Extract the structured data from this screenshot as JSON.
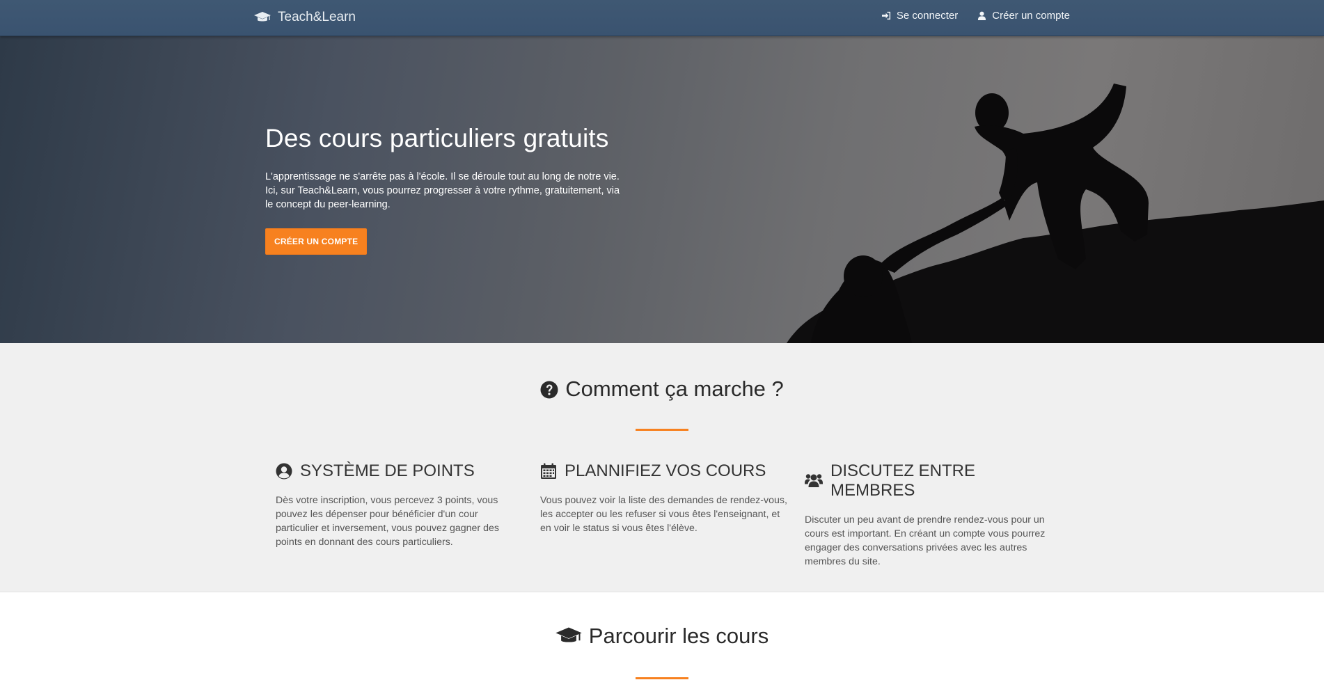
{
  "navbar": {
    "brand": "Teach&Learn",
    "brand_icon": "graduation-cap-icon",
    "links": [
      {
        "label": "Se connecter",
        "icon": "sign-in-icon"
      },
      {
        "label": "Créer un compte",
        "icon": "user-icon"
      }
    ]
  },
  "hero": {
    "title": "Des cours particuliers gratuits",
    "text": "L'apprentissage ne s'arrête pas à l'école. Il se déroule tout au long de notre vie. Ici, sur Teach&Learn, vous pourrez progresser à votre rythme, gratuitement, via le concept du peer-learning.",
    "cta": "CRÉER UN COMPTE"
  },
  "how": {
    "title": "Comment ça marche ?",
    "icon": "question-circle-icon",
    "features": [
      {
        "icon": "user-circle-icon",
        "title": "SYSTÈME DE POINTS",
        "text": "Dès votre inscription, vous percevez 3 points, vous pouvez les dépenser pour bénéficier d'un cour particulier et inversement, vous pouvez gagner des points en donnant des cours particuliers."
      },
      {
        "icon": "calendar-icon",
        "title": "PLANNIFIEZ VOS COURS",
        "text": "Vous pouvez voir la liste des demandes de rendez-vous, les accepter ou les refuser si vous êtes l'enseignant, et en voir le status si vous êtes l'élève."
      },
      {
        "icon": "users-icon",
        "title": "DISCUTEZ ENTRE MEMBRES",
        "text": "Discuter un peu avant de prendre rendez-vous pour un cours est important. En créant un compte vous pourrez engager des conversations privées avec les autres membres du site."
      }
    ]
  },
  "courses": {
    "title": "Parcourir les cours",
    "icon": "graduation-cap-icon"
  },
  "colors": {
    "navbar": "#3d5571",
    "accent": "#f7811f",
    "section_bg": "#f0f0f0"
  }
}
